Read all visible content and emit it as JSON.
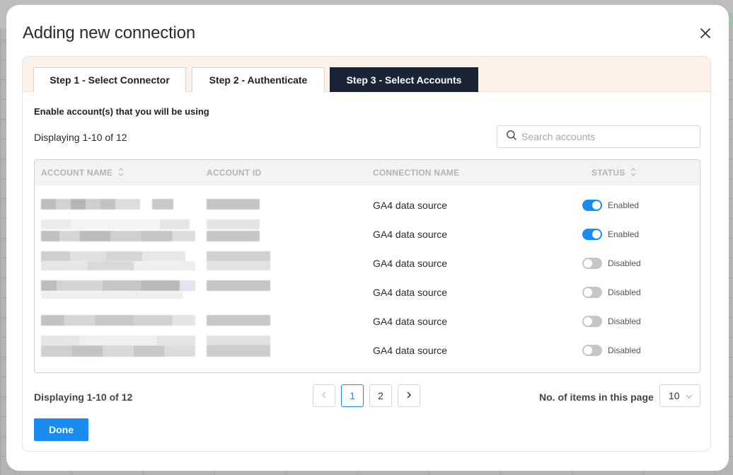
{
  "modal": {
    "title": "Adding new connection",
    "close_icon": "close-icon"
  },
  "steps": [
    {
      "label": "Step 1 - Select Connector",
      "active": false
    },
    {
      "label": "Step 2 - Authenticate",
      "active": false
    },
    {
      "label": "Step 3 - Select Accounts",
      "active": true
    }
  ],
  "content": {
    "instruction": "Enable account(s) that you will be using",
    "display_count_top": "Displaying 1-10 of 12",
    "search": {
      "placeholder": "Search accounts",
      "value": "",
      "icon": "search-icon"
    }
  },
  "table": {
    "columns": [
      "ACCOUNT NAME",
      "ACCOUNT ID",
      "CONNECTION NAME",
      "STATUS"
    ],
    "sortable": [
      "ACCOUNT NAME",
      "STATUS"
    ],
    "rows": [
      {
        "account_name": "",
        "account_id": "",
        "connection_name": "GA4 data source",
        "enabled": true,
        "status": "Enabled"
      },
      {
        "account_name": "",
        "account_id": "",
        "connection_name": "GA4 data source",
        "enabled": true,
        "status": "Enabled"
      },
      {
        "account_name": "",
        "account_id": "",
        "connection_name": "GA4 data source",
        "enabled": false,
        "status": "Disabled"
      },
      {
        "account_name": "",
        "account_id": "",
        "connection_name": "GA4 data source",
        "enabled": false,
        "status": "Disabled"
      },
      {
        "account_name": "",
        "account_id": "",
        "connection_name": "GA4 data source",
        "enabled": false,
        "status": "Disabled"
      },
      {
        "account_name": "",
        "account_id": "",
        "connection_name": "GA4 data source",
        "enabled": false,
        "status": "Disabled"
      }
    ]
  },
  "footer": {
    "display_count_bottom": "Displaying 1-10 of 12",
    "pagination": {
      "prev_icon": "chevron-left-icon",
      "pages": [
        "1",
        "2"
      ],
      "current": "1",
      "next_icon": "chevron-right-icon"
    },
    "items_per_page_label": "No. of items in this page",
    "items_per_page_value": "10",
    "done_label": "Done"
  },
  "colors": {
    "accent": "#1a8cf0",
    "active_tab": "#1b2436",
    "header_band": "#fdf2e9",
    "toggle_off": "#c6c6c6"
  }
}
